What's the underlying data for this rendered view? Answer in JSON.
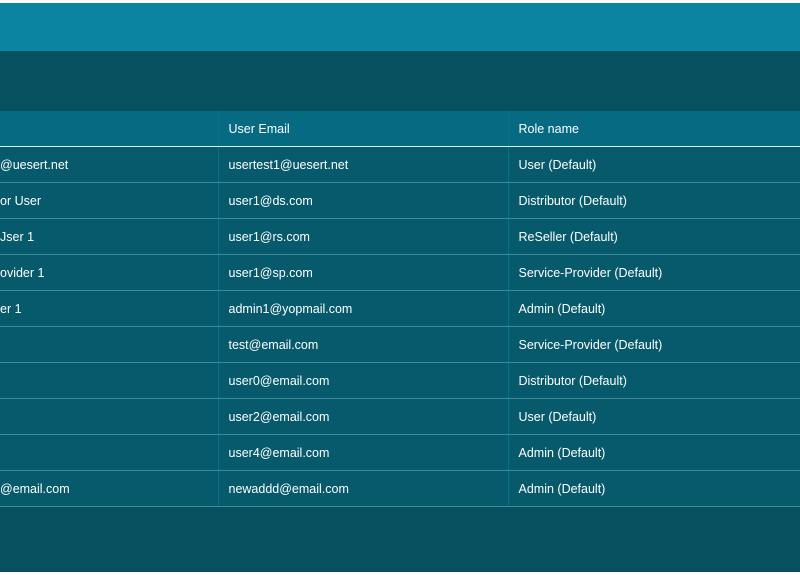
{
  "columns": [
    {
      "label": ""
    },
    {
      "label": "User Email"
    },
    {
      "label": "Role name"
    }
  ],
  "rows": [
    {
      "name": "@uesert.net",
      "email": "usertest1@uesert.net",
      "role": "User (Default)"
    },
    {
      "name": "or User",
      "email": "user1@ds.com",
      "role": "Distributor (Default)"
    },
    {
      "name": "Jser 1",
      "email": "user1@rs.com",
      "role": "ReSeller (Default)"
    },
    {
      "name": "ovider 1",
      "email": "user1@sp.com",
      "role": "Service-Provider (Default)"
    },
    {
      "name": "er 1",
      "email": "admin1@yopmail.com",
      "role": "Admin (Default)"
    },
    {
      "name": "",
      "email": "test@email.com",
      "role": "Service-Provider (Default)"
    },
    {
      "name": "",
      "email": "user0@email.com",
      "role": "Distributor (Default)"
    },
    {
      "name": "",
      "email": "user2@email.com",
      "role": "User (Default)"
    },
    {
      "name": "",
      "email": "user4@email.com",
      "role": "Admin (Default)"
    },
    {
      "name": "@email.com",
      "email": "newaddd@email.com",
      "role": "Admin (Default)"
    }
  ]
}
